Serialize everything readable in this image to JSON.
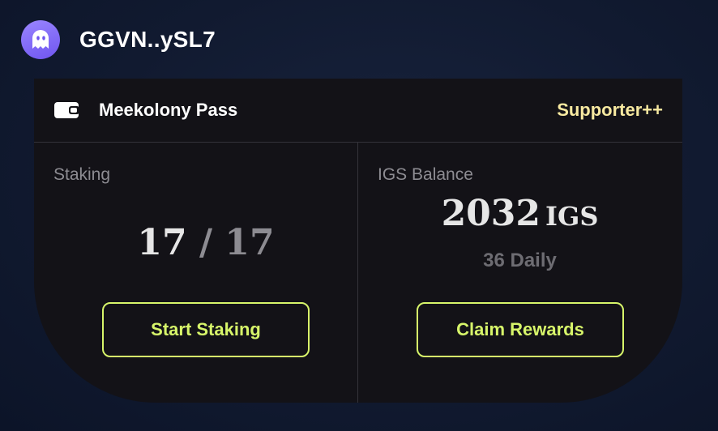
{
  "header": {
    "avatar_icon": "ghost-icon",
    "address": "GGVN..ySL7"
  },
  "pass": {
    "icon": "wallet-icon",
    "title": "Meekolony Pass",
    "tier": "Supporter++"
  },
  "staking": {
    "label": "Staking",
    "staked": "17",
    "separator": "/",
    "total": "17",
    "button_label": "Start Staking"
  },
  "balance": {
    "label": "IGS Balance",
    "amount": "2032",
    "unit": "IGS",
    "daily_amount": "36",
    "daily_label": "Daily",
    "button_label": "Claim Rewards"
  },
  "colors": {
    "accent": "#d7f56a",
    "tier": "#f7e9a0",
    "card": "#131217",
    "avatar": "#7b62f5"
  }
}
